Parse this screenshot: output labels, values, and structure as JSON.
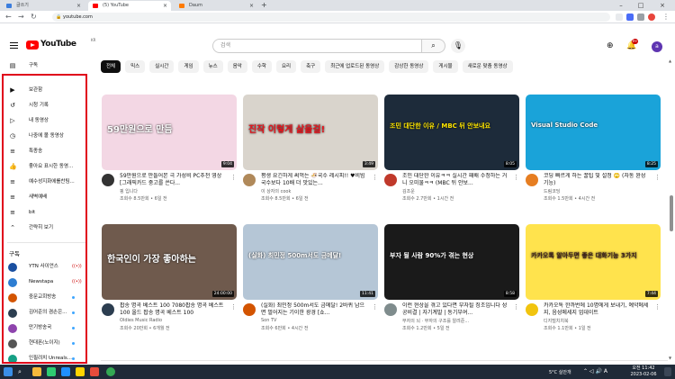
{
  "browser": {
    "tabs": [
      {
        "label": "글쓰기",
        "active": false,
        "favicon_color": "#3b7ddd"
      },
      {
        "label": "(5) YouTube",
        "active": true,
        "favicon_color": "#ff0000"
      },
      {
        "label": "Daum",
        "active": false,
        "favicon_color": "#ff7a00"
      }
    ],
    "new_tab": "+",
    "url": "youtube.com"
  },
  "header": {
    "logo_text": "YouTube",
    "logo_region": "KR",
    "search_placeholder": "검색",
    "bell_badge": "9+",
    "avatar_letter": "a"
  },
  "chips": [
    "전체",
    "믹스",
    "실시간",
    "게임",
    "뉴스",
    "음악",
    "수학",
    "요리",
    "축구",
    "최근에 업로드된 동영상",
    "감상한 동영상",
    "게시물",
    "새로운 맞춤 동영상"
  ],
  "sidebar": {
    "top_item": {
      "label": "구독",
      "icon": "subscriptions-icon"
    },
    "items": [
      {
        "label": "보관함",
        "icon": "library-icon",
        "glyph": "▶"
      },
      {
        "label": "시청 기록",
        "icon": "history-icon",
        "glyph": "↺"
      },
      {
        "label": "내 동영상",
        "icon": "my-videos-icon",
        "glyph": "▷"
      },
      {
        "label": "나중에 볼 동영상",
        "icon": "watch-later-icon",
        "glyph": "◷"
      },
      {
        "label": "특종송",
        "icon": "playlist-icon",
        "glyph": "≡"
      },
      {
        "label": "좋아요 표시한 동영...",
        "icon": "like-icon",
        "glyph": "👍"
      },
      {
        "label": "예수성지화에를찬팀...",
        "icon": "playlist-icon",
        "glyph": "≡"
      },
      {
        "label": "새벽예배",
        "icon": "playlist-icon",
        "glyph": "≡"
      },
      {
        "label": "bit",
        "icon": "playlist-icon",
        "glyph": "≡"
      },
      {
        "label": "간략히 보기",
        "icon": "chevron-up-icon",
        "glyph": "⌃"
      }
    ],
    "subscriptions_heading": "구독",
    "subscriptions": [
      {
        "label": "YTN 사이언스",
        "color": "#1a4fa0",
        "badge": "live"
      },
      {
        "label": "Newstapa",
        "color": "#2d7dd2",
        "badge": "live"
      },
      {
        "label": "중문교회방송",
        "color": "#d35400",
        "badge": "dot"
      },
      {
        "label": "김어준의 겸손은...",
        "color": "#2c3e50",
        "badge": "dot"
      },
      {
        "label": "만기방송국",
        "color": "#8e44ad",
        "badge": "dot"
      },
      {
        "label": "현대폰(노이지)",
        "color": "#555555",
        "badge": "dot"
      },
      {
        "label": "인필려치 Unreals...",
        "color": "#16a085",
        "badge": "dot"
      }
    ]
  },
  "videos": [
    {
      "title": "59만원으로 만들어본 극 가성비 PC추천 영상 [그래픽카드 중고를 쓴다...",
      "channel": "핑 입니다",
      "meta": "조회수 8.5만회 • 6일 전",
      "duration": "9:04",
      "thumb_bg": "#f3d7e4",
      "thumb_text": "59만원으로 만듬",
      "thumb_text_color": "#ffffff",
      "avatar_color": "#333333"
    },
    {
      "title": "평생 요긴하게 써먹는 🍜국수 레시피!! ♥비빔국수보다 10배 더 맛있는...",
      "channel": "이 상자의 cook",
      "meta": "조회수 8.5만회 • 6일 전",
      "duration": "3:49",
      "thumb_bg": "#d9d4cc",
      "thumb_text": "진작 이렇게 삶을걸!",
      "thumb_text_color": "#e8141c",
      "avatar_color": "#b0895a"
    },
    {
      "title": "조민 대단한 이유ㅋㅋ 실시간 패배 수정하는 거니 오미물ㅋㅋ (MBC 뒤 안보...",
      "channel": "김조운",
      "meta": "조회수 2.7만회 • 1시간 전",
      "duration": "8:05",
      "thumb_bg": "#1d2b3a",
      "thumb_text": "조민 대단한 이유 / MBC 뒤 안보내요",
      "thumb_text_color": "#ffe600",
      "avatar_color": "#c0392b"
    },
    {
      "title": "코딩 빠르게 하는 꿀팁 및 설정 🙄 (자동 완성 기능)",
      "channel": "드림코딩",
      "meta": "조회수 1.5만회 • 4시간 전",
      "duration": "8:25",
      "thumb_bg": "#1aa3d9",
      "thumb_text": "Visual Studio Code",
      "thumb_text_color": "#ffffff",
      "avatar_color": "#e67e22"
    },
    {
      "title": "팝송 명곡 베스트 100 7080팝송 명곡 베스트 100 올드 팝송 명곡 베스트 100",
      "channel": "Oldies Music Radio",
      "meta": "조회수 20만회 • 6개월 전",
      "duration": "24:00:00",
      "thumb_bg": "#6f5a4d",
      "thumb_text": "한국인이 가장 좋아하는",
      "thumb_text_color": "#ffffff",
      "avatar_color": "#2c3e50"
    },
    {
      "title": "(실화) 최민정 500m서도 금메달! 2바퀴 남으면 벌어지는 기이한 광경 [쇼...",
      "channel": "Son TV",
      "meta": "조회수 6만회 • 4시간 전",
      "duration": "11:41",
      "thumb_bg": "#b5c6d6",
      "thumb_text": "(실화) 최민정 500m서도 금메달!",
      "thumb_text_color": "#ffffff",
      "avatar_color": "#d35400"
    },
    {
      "title": "이런 현상을 겪고 있다면 부자될 징조입니다 성공비결 | 자기계발 | 동기부여...",
      "channel": "부자의 뇌 · 부자의 구조를 알려준...",
      "meta": "조회수 1.2만회 • 5일 전",
      "duration": "8:58",
      "thumb_bg": "#1a1a1a",
      "thumb_text": "부자 될 사람 90%가 겪는 현상",
      "thumb_text_color": "#ffffff",
      "avatar_color": "#7f8c8d"
    },
    {
      "title": "카카오톡 한까번에 10명에게 보내기, 예약메세지, 음성메세지 업데이트",
      "channel": "디지털치치북",
      "meta": "조회수 1.1만회 • 1일 전",
      "duration": "7:44",
      "thumb_bg": "#ffe34d",
      "thumb_text": "카카오톡 알아두면 좋은 대화기능 3가지",
      "thumb_text_color": "#3a1d1d",
      "avatar_color": "#f1c40f"
    }
  ],
  "taskbar": {
    "weather": "5°C 실안개",
    "clock_time": "오전 11:42",
    "clock_date": "2023-02-06"
  }
}
